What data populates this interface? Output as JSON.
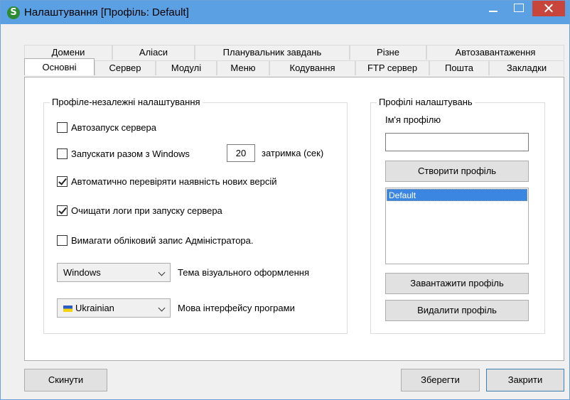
{
  "window": {
    "title": "Налаштування [Профіль: Default]",
    "app_icon_letter": "S"
  },
  "tabs": {
    "row_back": [
      "Домени",
      "Аліаси",
      "Планувальник завдань",
      "Різне",
      "Автозавантаження"
    ],
    "row_front": [
      "Основні",
      "Сервер",
      "Модулі",
      "Меню",
      "Кодування",
      "FTP сервер",
      "Пошта",
      "Закладки"
    ],
    "active": "Основні"
  },
  "independent": {
    "group_title": "Профіле-незалежні налаштування",
    "autostart_label": "Автозапуск сервера",
    "autostart_checked": false,
    "with_windows_label": "Запускати разом з Windows",
    "with_windows_checked": false,
    "delay_value": "20",
    "delay_label": "затримка (сек)",
    "check_updates_label": "Автоматично перевіряти наявність нових версій",
    "check_updates_checked": true,
    "clear_logs_label": "Очищати логи при запуску сервера",
    "clear_logs_checked": true,
    "require_admin_label": "Вимагати обліковий запис Адміністратора.",
    "require_admin_checked": false,
    "theme_value": "Windows",
    "theme_label": "Тема візуального оформлення",
    "language_value": "Ukrainian",
    "language_label": "Мова інтерфейсу програми"
  },
  "profiles": {
    "group_title": "Профілі налаштувань",
    "name_label": "Ім'я профілю",
    "name_value": "",
    "create_button": "Створити профіль",
    "items": [
      "Default"
    ],
    "load_button": "Завантажити профіль",
    "delete_button": "Видалити профіль"
  },
  "footer": {
    "reset_button": "Скинути",
    "save_button": "Зберегти",
    "close_button": "Закрити"
  }
}
